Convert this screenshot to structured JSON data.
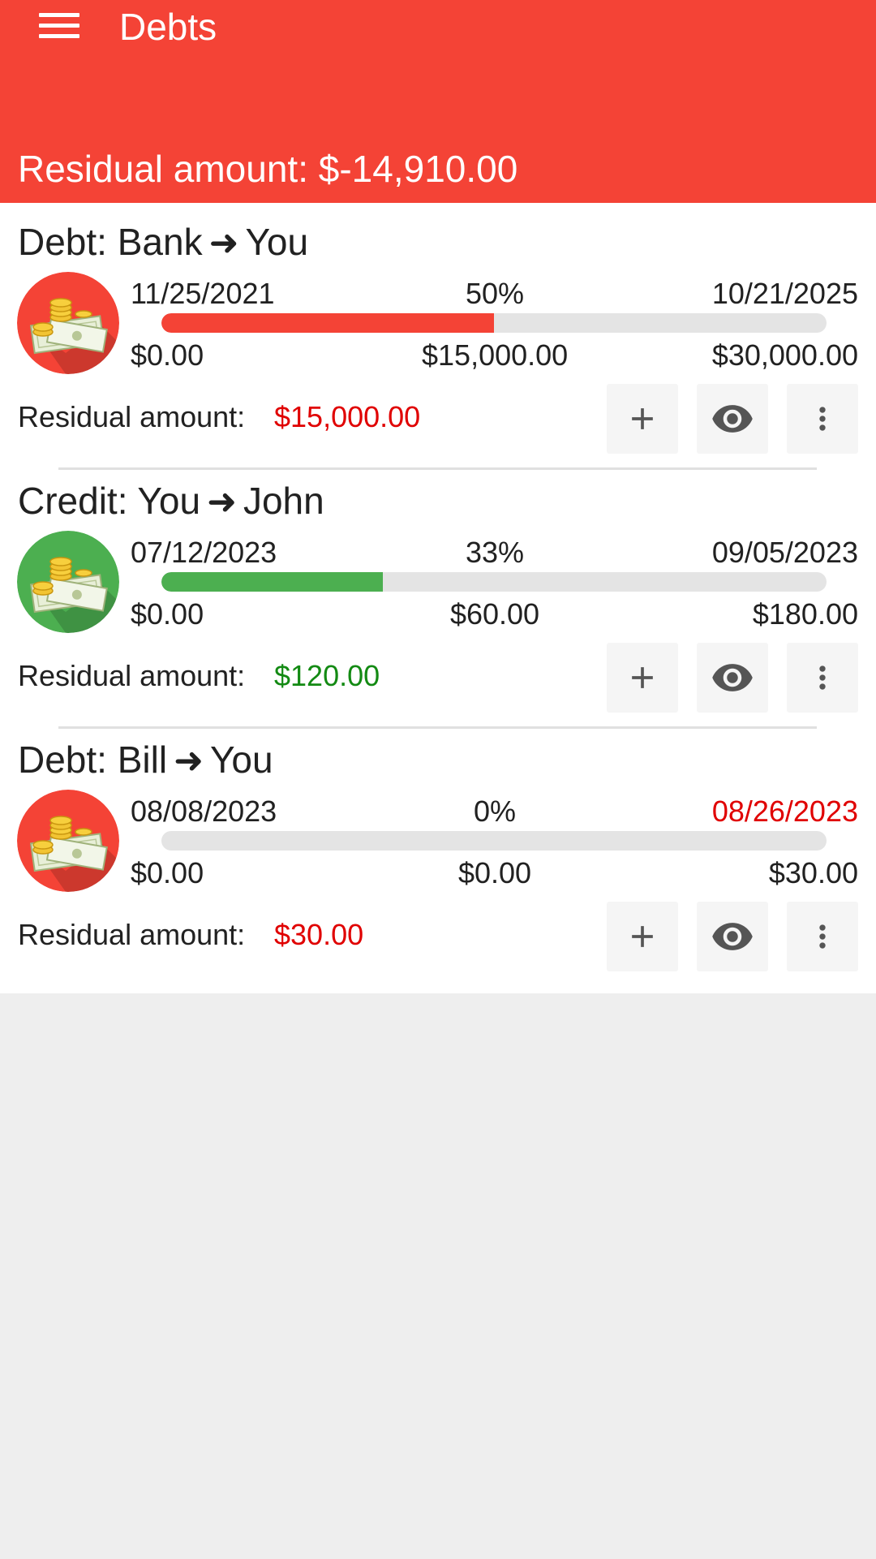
{
  "appbar": {
    "title": "Debts",
    "total_label": "Residual amount: $-14,910.00",
    "color": "#f44336"
  },
  "cards": [
    {
      "title": "Debt: Bank",
      "arrow": "➜",
      "party": "You",
      "avatar_color": "#f44336",
      "start_date": "11/25/2021",
      "percent": "50%",
      "end_date": "10/21/2025",
      "end_date_color": "#212121",
      "amount_min": "$0.00",
      "amount_paid": "$15,000.00",
      "amount_max": "$30,000.00",
      "progress": 0.5,
      "bar_color": "#f44336",
      "residual_label": "Residual amount:",
      "residual_value": "$15,000.00",
      "residual_color": "#e00000"
    },
    {
      "title": "Credit: You",
      "arrow": "➜",
      "party": "John",
      "avatar_color": "#4caf50",
      "start_date": "07/12/2023",
      "percent": "33%",
      "end_date": "09/05/2023",
      "end_date_color": "#212121",
      "amount_min": "$0.00",
      "amount_paid": "$60.00",
      "amount_max": "$180.00",
      "progress": 0.333,
      "bar_color": "#4caf50",
      "residual_label": "Residual amount:",
      "residual_value": "$120.00",
      "residual_color": "#138a13"
    },
    {
      "title": "Debt: Bill",
      "arrow": "➜",
      "party": "You",
      "avatar_color": "#f44336",
      "start_date": "08/08/2023",
      "percent": "0%",
      "end_date": "08/26/2023",
      "end_date_color": "#e00000",
      "amount_min": "$0.00",
      "amount_paid": "$0.00",
      "amount_max": "$30.00",
      "progress": 0,
      "bar_color": "#f44336",
      "residual_label": "Residual amount:",
      "residual_value": "$30.00",
      "residual_color": "#e00000"
    }
  ],
  "icons": {
    "menu": "menu-icon",
    "avatar": "money-icon",
    "add": "plus-icon",
    "view": "eye-icon",
    "more": "more-vert-icon"
  }
}
